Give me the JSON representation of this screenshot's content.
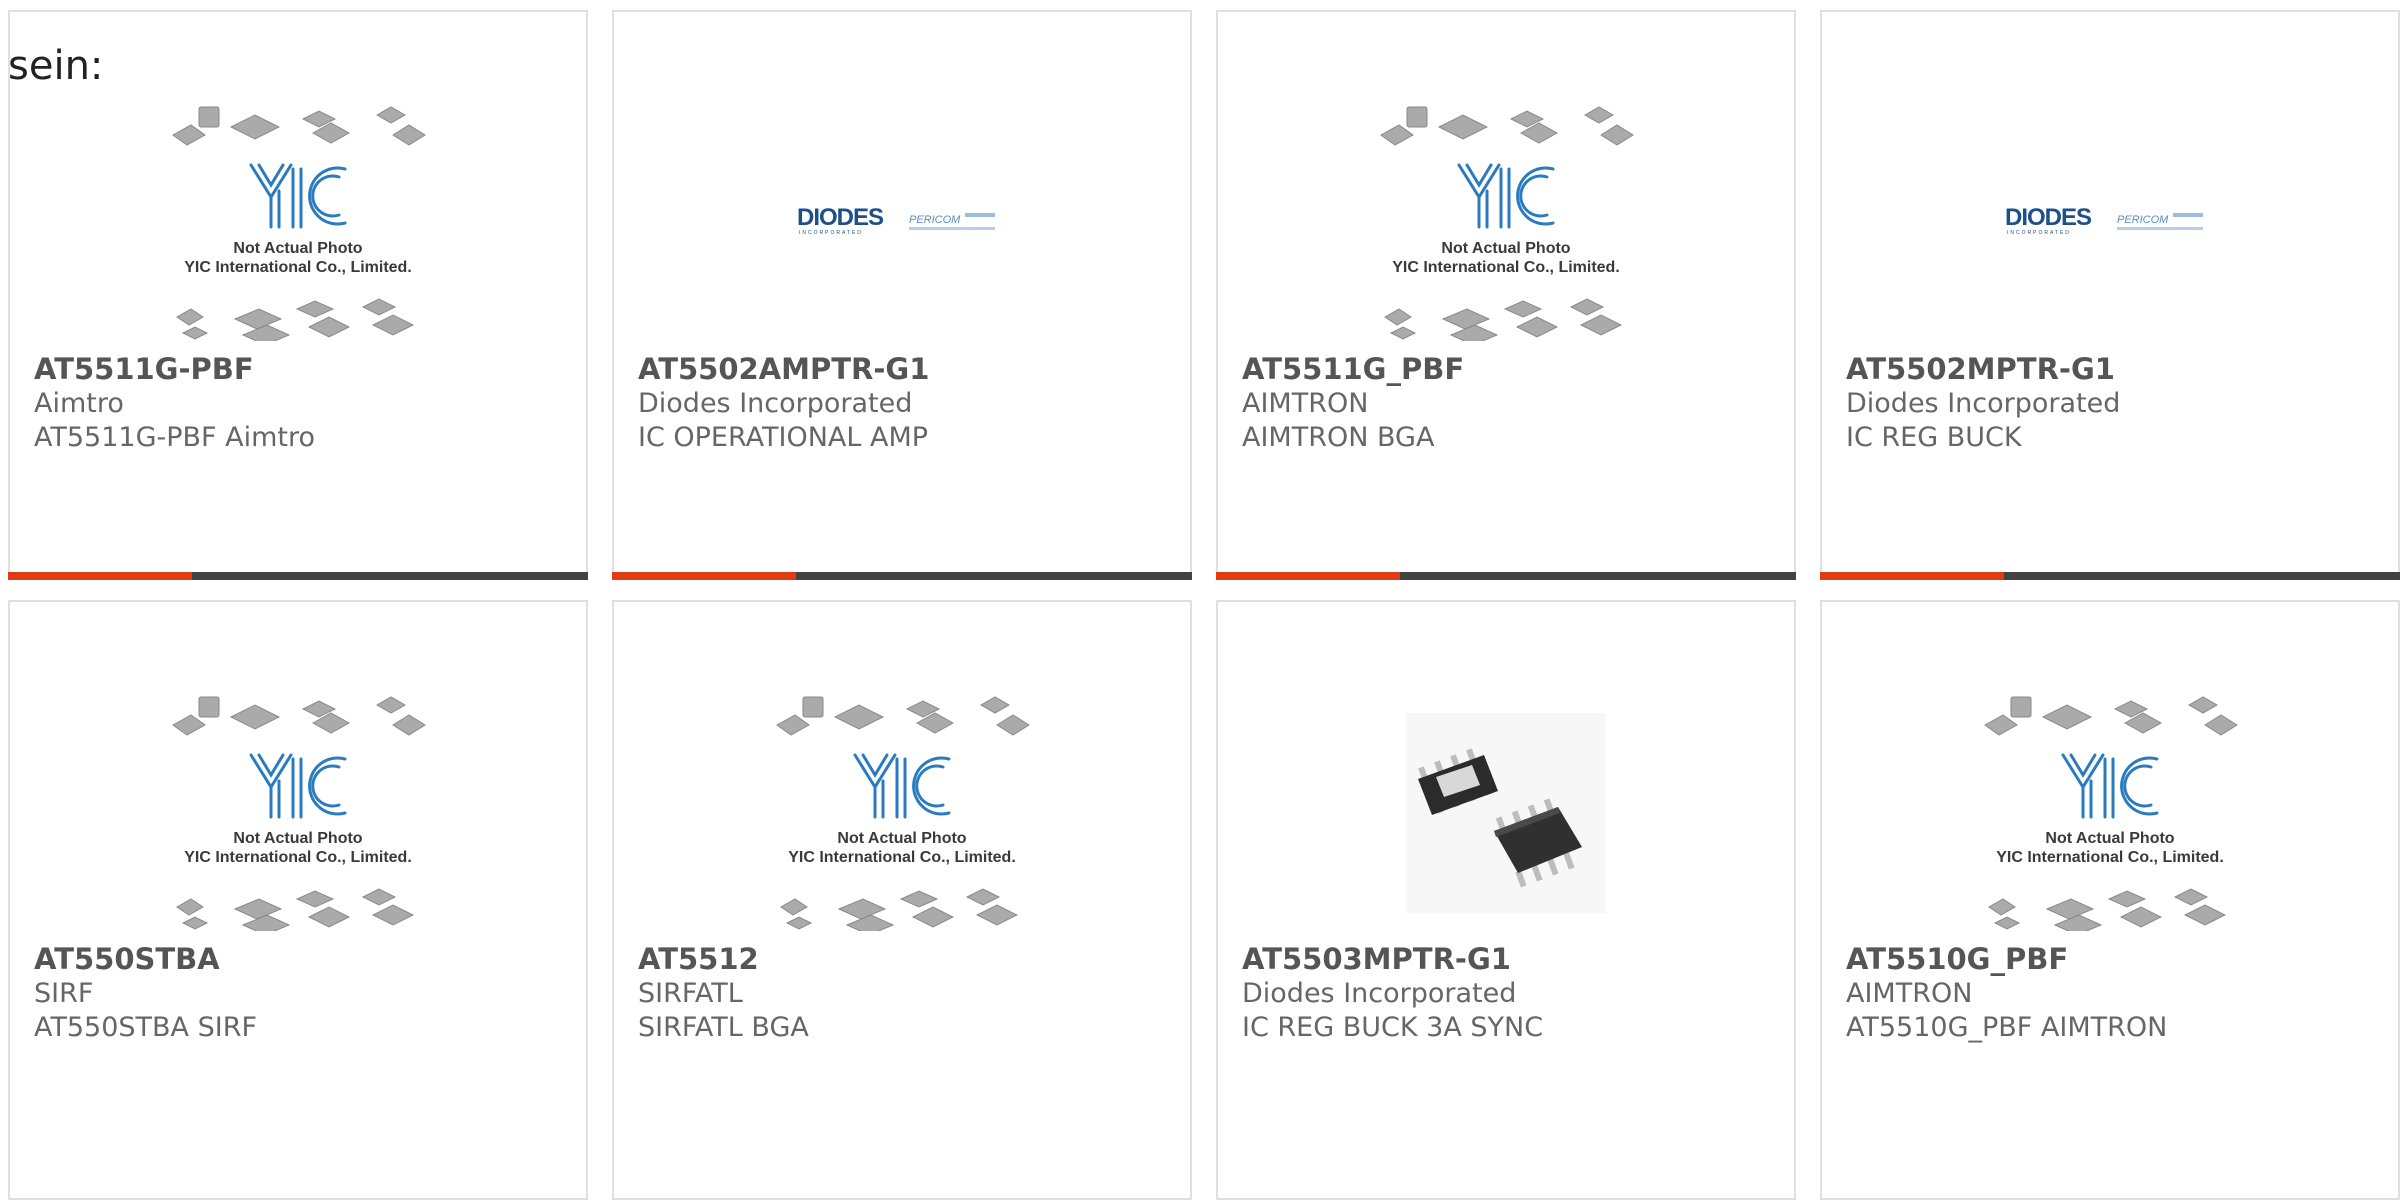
{
  "page": {
    "fragment_text": "sein:"
  },
  "placeholder": {
    "line1": "Not Actual Photo",
    "line2": "YIC International Co., Limited.",
    "logo_letters": "YIC"
  },
  "logos": {
    "diodes": "DIODES",
    "diodes_sub": "INCORPORATED",
    "pericom": "PERICOM"
  },
  "products": [
    {
      "part": "AT5511G-PBF",
      "manufacturer": "Aimtro",
      "description": "AT5511G-PBF Aimtro",
      "image": "yic-placeholder"
    },
    {
      "part": "AT5502AMPTR-G1",
      "manufacturer": "Diodes Incorporated",
      "description": "IC OPERATIONAL AMP",
      "image": "diodes-pericom-logo"
    },
    {
      "part": "AT5511G_PBF",
      "manufacturer": "AIMTRON",
      "description": "AIMTRON BGA",
      "image": "yic-placeholder"
    },
    {
      "part": "AT5502MPTR-G1",
      "manufacturer": "Diodes Incorporated",
      "description": "IC REG BUCK",
      "image": "diodes-pericom-logo"
    },
    {
      "part": "AT550STBA",
      "manufacturer": "SIRF",
      "description": "AT550STBA SIRF",
      "image": "yic-placeholder"
    },
    {
      "part": "AT5512",
      "manufacturer": "SIRFATL",
      "description": "SIRFATL BGA",
      "image": "yic-placeholder"
    },
    {
      "part": "AT5503MPTR-G1",
      "manufacturer": "Diodes Incorporated",
      "description": "IC REG BUCK 3A SYNC",
      "image": "soic8-chip-photo"
    },
    {
      "part": "AT5510G_PBF",
      "manufacturer": "AIMTRON",
      "description": "AT5510G_PBF AIMTRON",
      "image": "yic-placeholder"
    }
  ],
  "colors": {
    "accent_orange": "#e03b12",
    "bar_dark": "#424242",
    "yic_blue": "#2a7bbf",
    "diodes_blue": "#1d4f8a",
    "pericom_blue": "#5a8fc4"
  }
}
